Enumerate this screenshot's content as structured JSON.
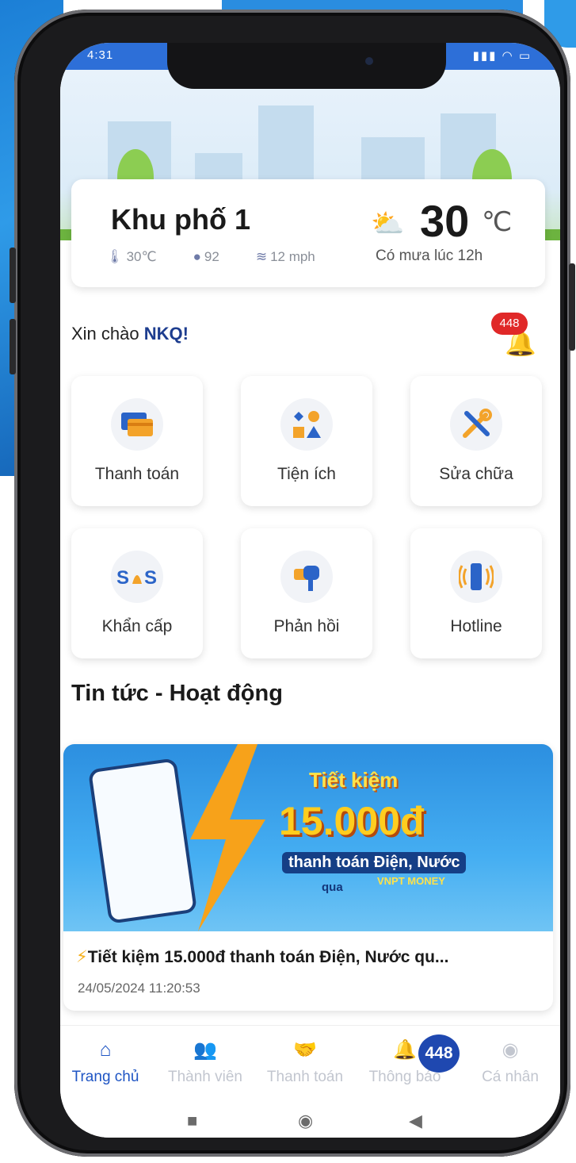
{
  "status_bar": {
    "time": "4:31",
    "signal_text": "📶",
    "wifi_text": "◡",
    "battery_text": "▭"
  },
  "weather": {
    "location": "Khu phố 1",
    "temperature": "30",
    "unit": "℃",
    "description": "Có mưa lúc 12h",
    "stats": [
      {
        "icon": "thermometer-icon",
        "value": "30℃"
      },
      {
        "icon": "humidity-icon",
        "value": "92"
      },
      {
        "icon": "wind-icon",
        "value": "12 mph"
      }
    ]
  },
  "greeting": {
    "prefix": "Xin chào ",
    "name": "NKQ!"
  },
  "notifications": {
    "count": "448"
  },
  "services": [
    {
      "label": "Thanh toán",
      "icon": "payment-card-icon"
    },
    {
      "label": "Tiện ích",
      "icon": "utilities-icon"
    },
    {
      "label": "Sửa chữa",
      "icon": "repair-tools-icon"
    },
    {
      "label": "Khẩn cấp",
      "icon": "sos-icon"
    },
    {
      "label": "Phản hồi",
      "icon": "mailbox-icon"
    },
    {
      "label": "Hotline",
      "icon": "phone-ringing-icon"
    }
  ],
  "news": {
    "section_title": "Tin tức - Hoạt động",
    "banner": {
      "line1": "Tiết kiệm",
      "amount": "15.000đ",
      "line2": "thanh toán Điện, Nước",
      "via": "qua",
      "brand": "VNPT MONEY"
    },
    "headline_icon": "⚡",
    "headline": "Tiết kiệm 15.000đ thanh toán Điện, Nước qu...",
    "date": "24/05/2024 11:20:53"
  },
  "tab_bar": {
    "tabs": [
      {
        "label": "Trang chủ",
        "icon": "home-icon",
        "active": true
      },
      {
        "label": "Thành viên",
        "icon": "members-icon",
        "active": false
      },
      {
        "label": "Thanh toán",
        "icon": "handshake-icon",
        "active": false
      },
      {
        "label": "Thông báo",
        "icon": "bell-icon",
        "active": false
      },
      {
        "label": "Cá nhân",
        "icon": "profile-icon",
        "active": false
      }
    ],
    "notification_badge": "448"
  },
  "colors": {
    "primary": "#1f55c4",
    "badge_red": "#e02828",
    "status_bar": "#2d6fd8"
  }
}
